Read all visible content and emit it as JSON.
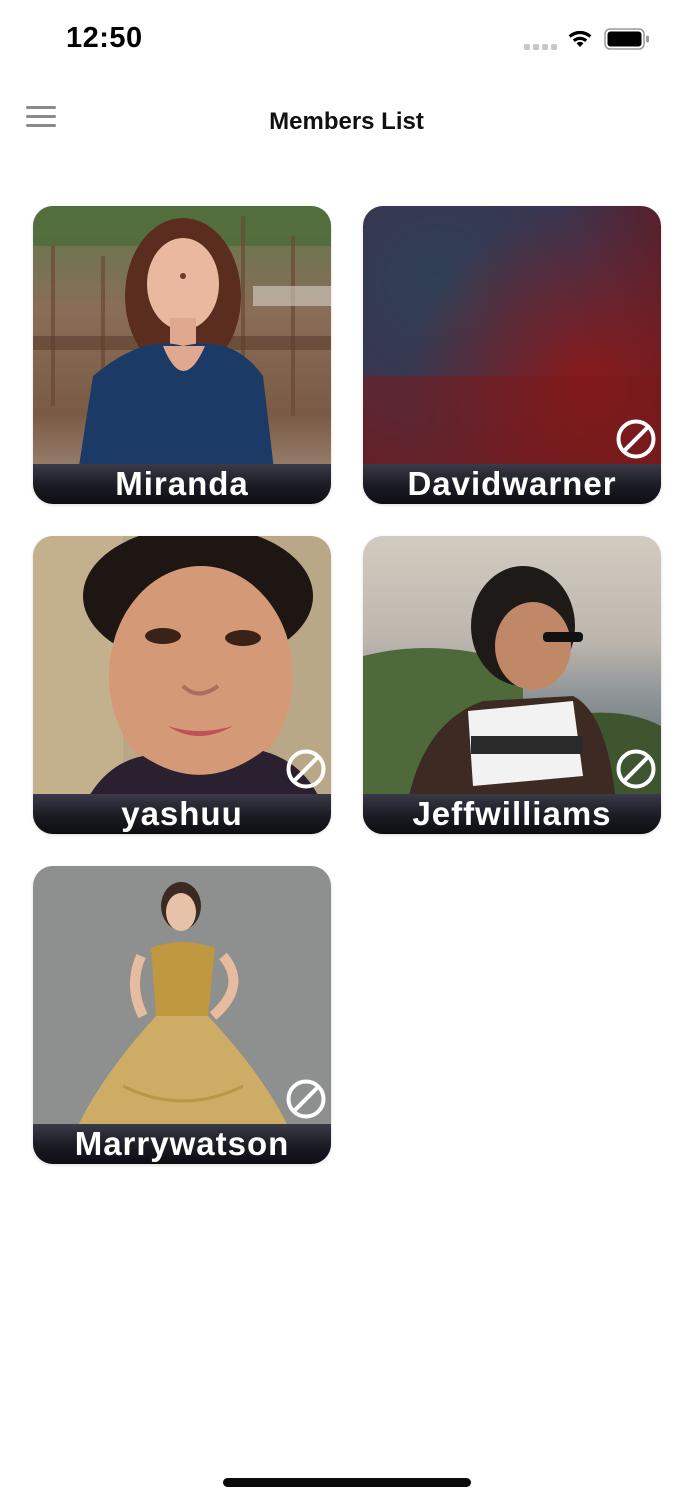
{
  "status_bar": {
    "time": "12:50",
    "icons": [
      "signal-icon",
      "wifi-icon",
      "battery-icon"
    ]
  },
  "header": {
    "title": "Members List",
    "menu_icon": "hamburger-menu-icon"
  },
  "members": [
    {
      "name": "Miranda",
      "blocked_icon": false,
      "photo": "woman-blue-dress-photo"
    },
    {
      "name": "Davidwarner",
      "blocked_icon": true,
      "photo": "blurred-red-blue-photo"
    },
    {
      "name": "yashuu",
      "blocked_icon": true,
      "photo": "woman-closeup-photo"
    },
    {
      "name": "Jeffwilliams",
      "blocked_icon": true,
      "photo": "man-sunglasses-seaside-photo"
    },
    {
      "name": "Marrywatson",
      "blocked_icon": true,
      "photo": "woman-gold-gown-photo"
    }
  ],
  "colors": {
    "name_bar": "#1b1b24",
    "title": "#111111",
    "menu_icon": "#8a8a8e"
  }
}
